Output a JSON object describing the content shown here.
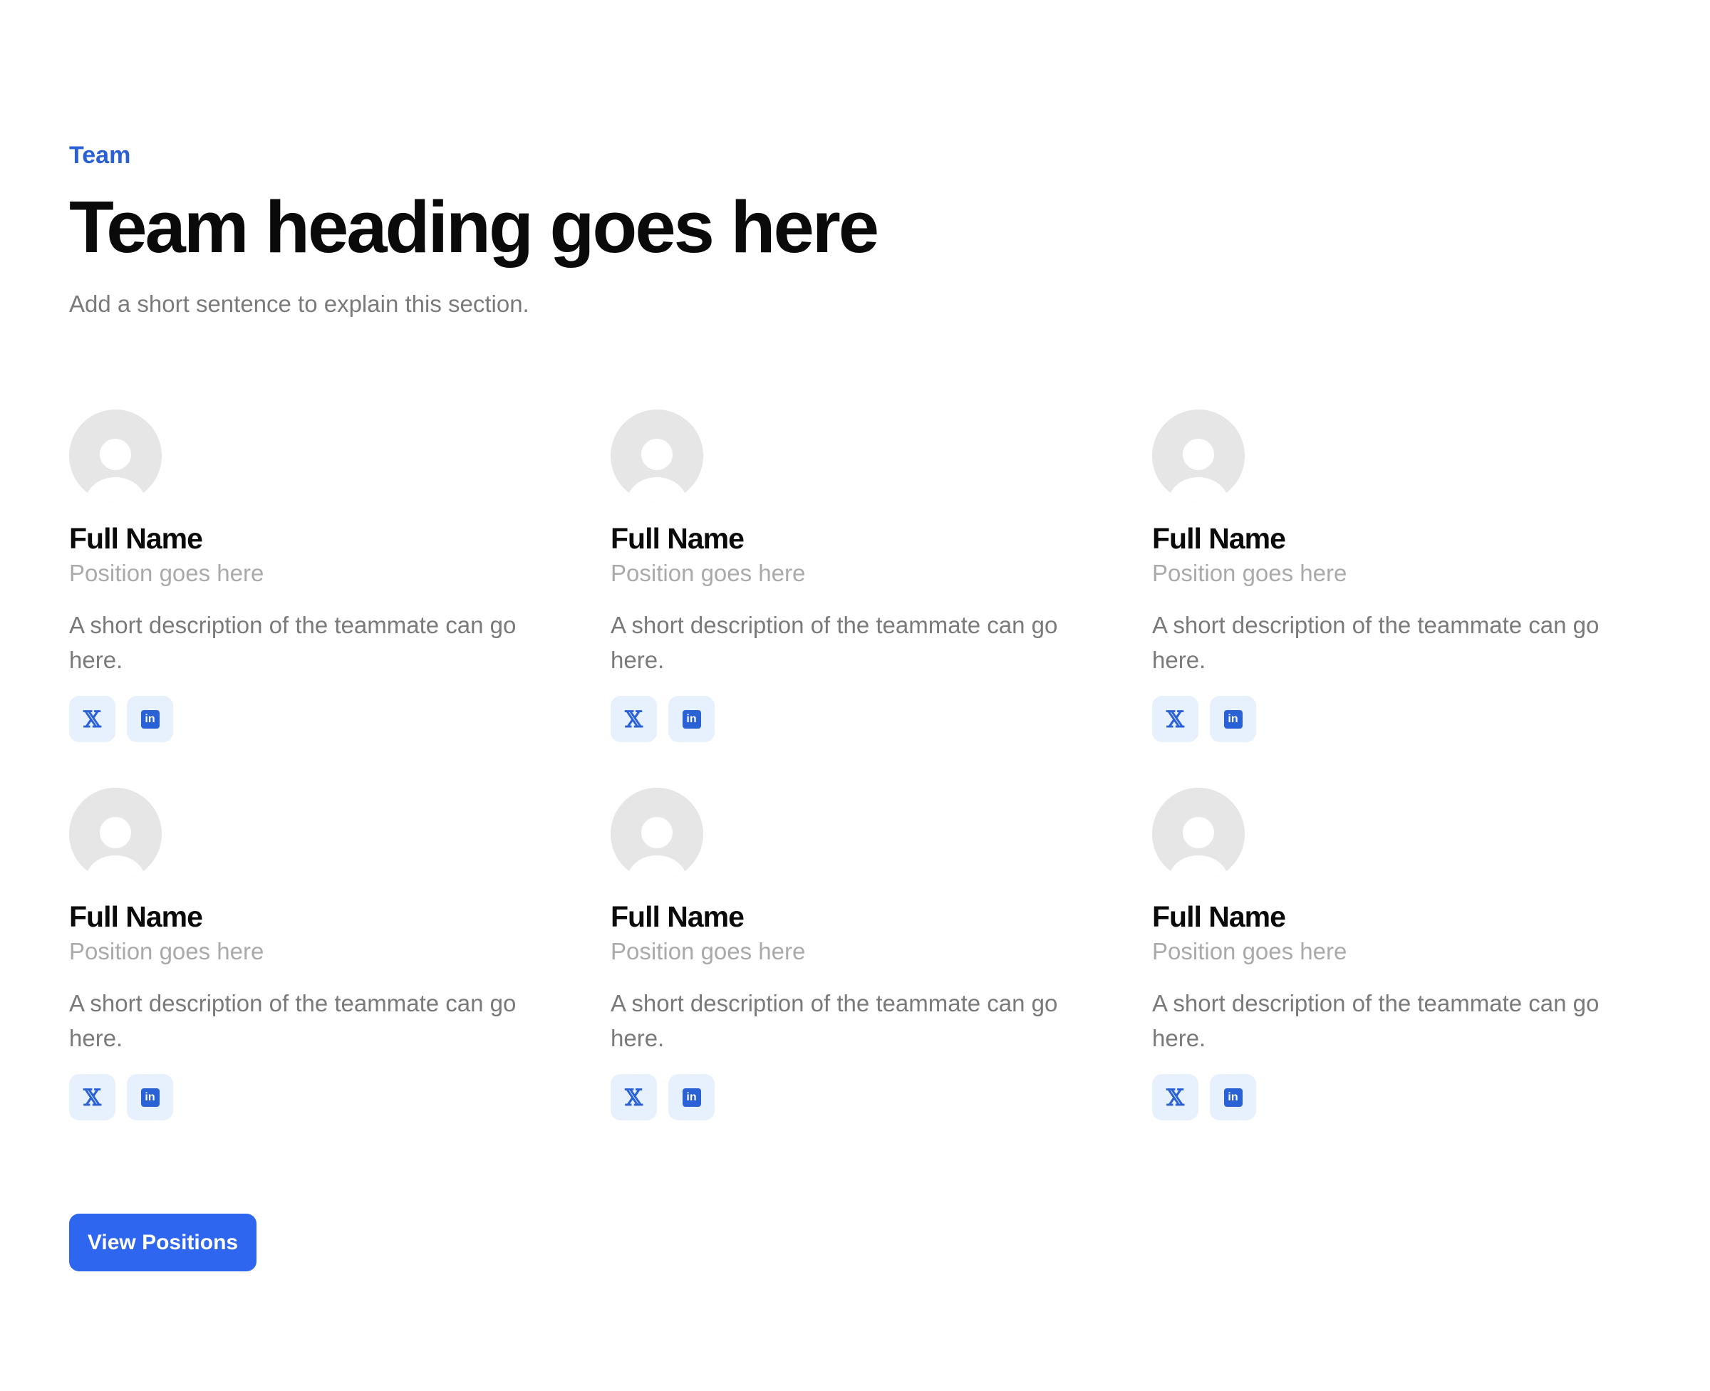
{
  "section": {
    "eyebrow": "Team",
    "heading": "Team heading goes here",
    "subtitle": "Add a short sentence to explain this section."
  },
  "members": [
    {
      "name": "Full Name",
      "position": "Position goes here",
      "description": "A short description of the teammate can go here.",
      "social_x": "𝕏",
      "social_linkedin": "in"
    },
    {
      "name": "Full Name",
      "position": "Position goes here",
      "description": "A short description of the teammate can go here.",
      "social_x": "𝕏",
      "social_linkedin": "in"
    },
    {
      "name": "Full Name",
      "position": "Position goes here",
      "description": "A short description of the teammate can go here.",
      "social_x": "𝕏",
      "social_linkedin": "in"
    },
    {
      "name": "Full Name",
      "position": "Position goes here",
      "description": "A short description of the teammate can go here.",
      "social_x": "𝕏",
      "social_linkedin": "in"
    },
    {
      "name": "Full Name",
      "position": "Position goes here",
      "description": "A short description of the teammate can go here.",
      "social_x": "𝕏",
      "social_linkedin": "in"
    },
    {
      "name": "Full Name",
      "position": "Position goes here",
      "description": "A short description of the teammate can go here.",
      "social_x": "𝕏",
      "social_linkedin": "in"
    }
  ],
  "icons": {
    "avatar": "user-placeholder-icon",
    "x": "x-twitter-icon",
    "linkedin": "linkedin-icon"
  },
  "cta": {
    "label": "View Positions"
  },
  "colors": {
    "accent": "#2a62d6",
    "button": "#2e66f0",
    "icon_bg": "#e7f0fd",
    "avatar_bg": "#e6e6e6"
  }
}
